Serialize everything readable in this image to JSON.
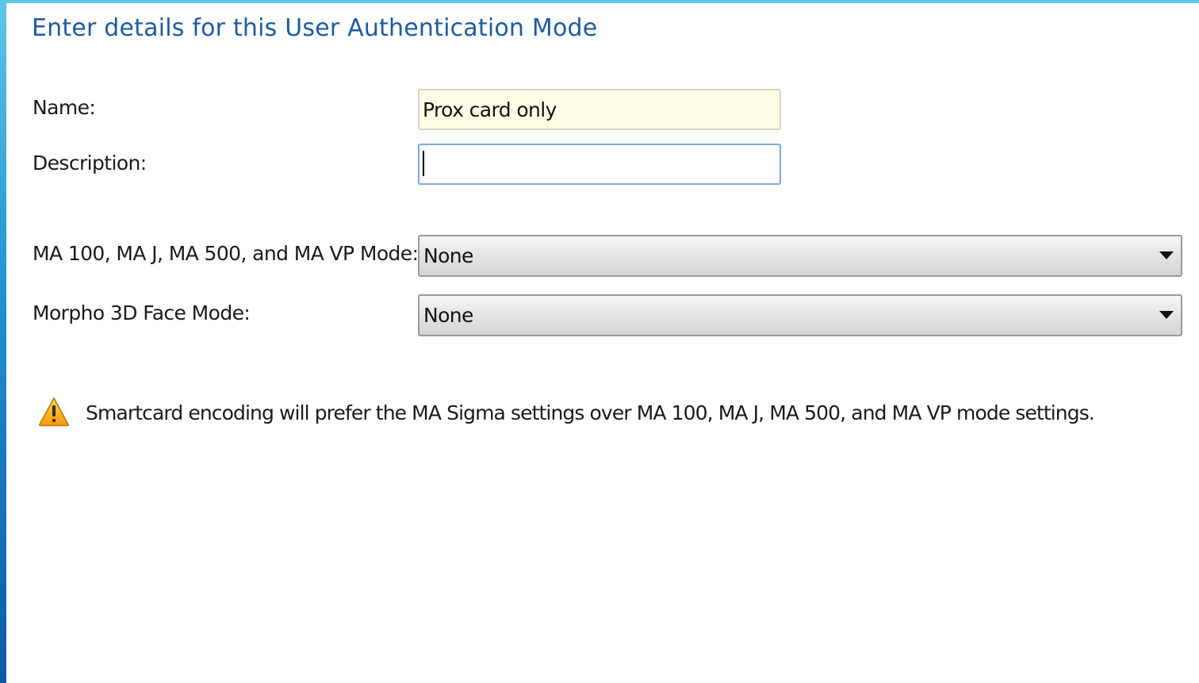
{
  "heading": "Enter details for this User Authentication Mode",
  "fields": {
    "name": {
      "label": "Name:",
      "value": "Prox card only"
    },
    "description": {
      "label": "Description:",
      "value": ""
    }
  },
  "selects": {
    "ma_mode": {
      "label": "MA 100, MA J, MA 500, and MA VP Mode:",
      "value": "None"
    },
    "morpho_mode": {
      "label": "Morpho 3D Face Mode:",
      "value": "None"
    }
  },
  "warning": {
    "icon": "warning-icon",
    "text": "Smartcard encoding will prefer the MA Sigma settings over MA 100, MA J, MA 500, and MA VP mode settings."
  },
  "colors": {
    "heading": "#1e5aa0",
    "name_field_bg": "#fefee6",
    "warning_icon": "#f5a623",
    "frame": "#1e8fd0"
  }
}
